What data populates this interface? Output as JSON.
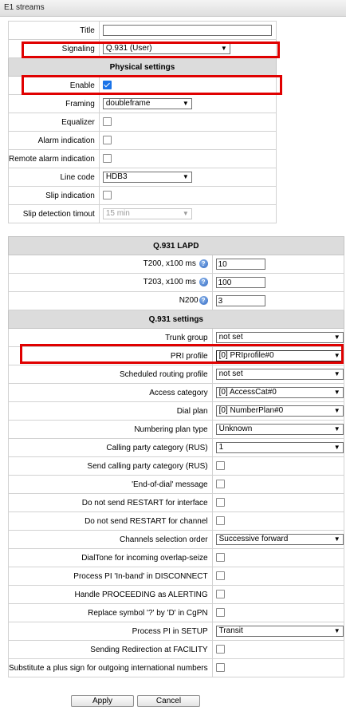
{
  "window": {
    "title": "E1 streams"
  },
  "stream": {
    "title": {
      "label": "Title",
      "value": ""
    },
    "signaling": {
      "label": "Signaling",
      "value": "Q.931 (User)"
    },
    "physical_section": "Physical settings",
    "enable": {
      "label": "Enable",
      "checked": true
    },
    "framing": {
      "label": "Framing",
      "value": "doubleframe"
    },
    "equalizer": {
      "label": "Equalizer",
      "checked": false
    },
    "alarm_indication": {
      "label": "Alarm indication",
      "checked": false
    },
    "remote_alarm_indication": {
      "label": "Remote alarm indication",
      "checked": false
    },
    "line_code": {
      "label": "Line code",
      "value": "HDB3"
    },
    "slip_indication": {
      "label": "Slip indication",
      "checked": false
    },
    "slip_detection_timeout": {
      "label": "Slip detection timout",
      "value": "15 min"
    }
  },
  "lapd": {
    "section": "Q.931 LAPD",
    "t200": {
      "label": "T200, x100 ms",
      "value": "10"
    },
    "t203": {
      "label": "T203, x100 ms",
      "value": "100"
    },
    "n200": {
      "label": "N200",
      "value": "3"
    }
  },
  "q931": {
    "section": "Q.931 settings",
    "trunk_group": {
      "label": "Trunk group",
      "value": "not set"
    },
    "pri_profile": {
      "label": "PRI profile",
      "value": "[0] PRIprofile#0"
    },
    "scheduled_routing_profile": {
      "label": "Scheduled routing profile",
      "value": "not set"
    },
    "access_category": {
      "label": "Access category",
      "value": "[0] AccessCat#0"
    },
    "dial_plan": {
      "label": "Dial plan",
      "value": "[0] NumberPlan#0"
    },
    "numbering_plan_type": {
      "label": "Numbering plan type",
      "value": "Unknown"
    },
    "calling_party_category": {
      "label": "Calling party category (RUS)",
      "value": "1"
    },
    "send_calling_party_category": {
      "label": "Send calling party category (RUS)",
      "checked": false
    },
    "end_of_dial_message": {
      "label": "'End-of-dial' message",
      "checked": false
    },
    "no_restart_interface": {
      "label": "Do not send RESTART for interface",
      "checked": false
    },
    "no_restart_channel": {
      "label": "Do not send RESTART for channel",
      "checked": false
    },
    "channels_selection_order": {
      "label": "Channels selection order",
      "value": "Successive forward"
    },
    "dialtone_overlap": {
      "label": "DialTone for incoming overlap-seize",
      "checked": false
    },
    "pi_inband_disconnect": {
      "label": "Process PI 'In-band' in DISCONNECT",
      "checked": false
    },
    "proceeding_as_alerting": {
      "label": "Handle PROCEEDING as ALERTING",
      "checked": false
    },
    "replace_symbol": {
      "label": "Replace symbol '?' by 'D' in CgPN",
      "checked": false
    },
    "process_pi_setup": {
      "label": "Process PI in SETUP",
      "value": "Transit"
    },
    "redirection_facility": {
      "label": "Sending Redirection at FACILITY",
      "checked": false
    },
    "plus_sign_substitute": {
      "label": "Substitute a plus sign for outgoing international numbers",
      "checked": false
    }
  },
  "icons": {
    "help": "help-icon",
    "dropdown": "chevron-down-icon",
    "checkbox": "checkbox-icon"
  },
  "buttons": {
    "apply": "Apply",
    "cancel": "Cancel"
  },
  "colors": {
    "highlight": "#e00000",
    "section_bg": "#dcdcdc",
    "checkbox_on": "#1a73e8"
  }
}
